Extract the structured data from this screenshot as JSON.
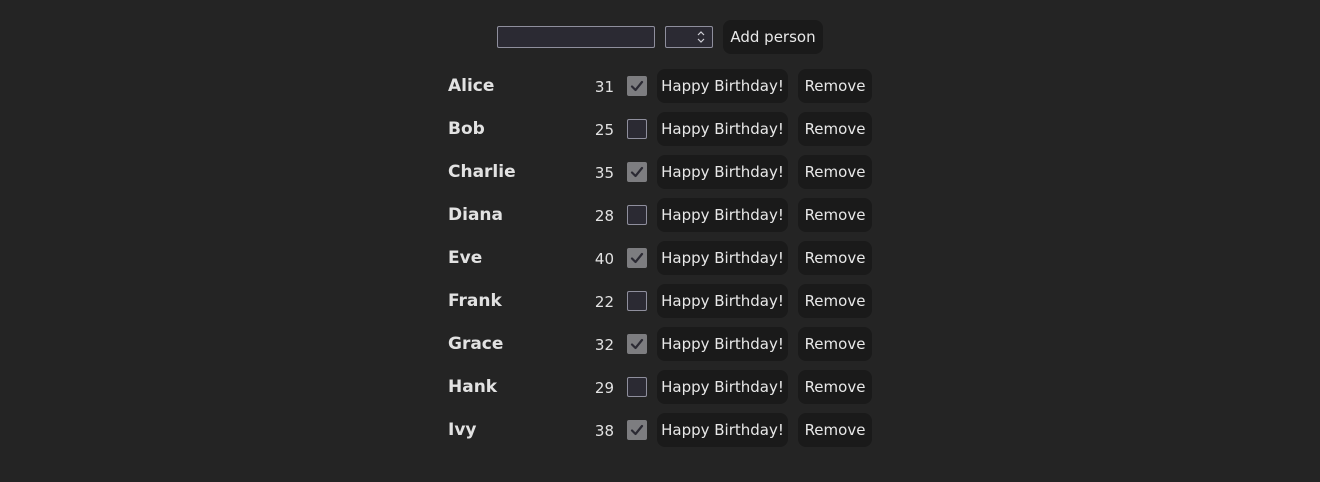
{
  "form": {
    "name_value": "",
    "age_value": "",
    "add_label": "Add person"
  },
  "people": [
    {
      "name": "Alice",
      "age": "31",
      "checked": true
    },
    {
      "name": "Bob",
      "age": "25",
      "checked": false
    },
    {
      "name": "Charlie",
      "age": "35",
      "checked": true
    },
    {
      "name": "Diana",
      "age": "28",
      "checked": false
    },
    {
      "name": "Eve",
      "age": "40",
      "checked": true
    },
    {
      "name": "Frank",
      "age": "22",
      "checked": false
    },
    {
      "name": "Grace",
      "age": "32",
      "checked": true
    },
    {
      "name": "Hank",
      "age": "29",
      "checked": false
    },
    {
      "name": "Ivy",
      "age": "38",
      "checked": true
    }
  ],
  "row_actions": {
    "birthday_label": "Happy Birthday!",
    "remove_label": "Remove"
  },
  "icons": {
    "checkbox_mark": "check-icon",
    "spinner": "spinner-arrows-icon"
  }
}
